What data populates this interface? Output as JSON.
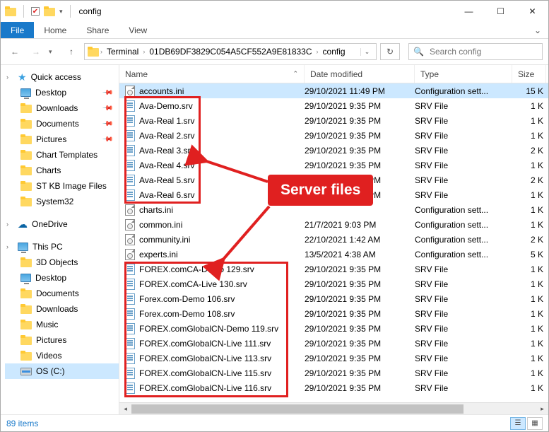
{
  "title": "config",
  "tabs": {
    "file": "File",
    "home": "Home",
    "share": "Share",
    "view": "View"
  },
  "nav": {
    "crumb1": "Terminal",
    "crumb2": "01DB69DF3829C054A5CF552A9E81833C",
    "crumb3": "config"
  },
  "search": {
    "placeholder": "Search config"
  },
  "cols": {
    "name": "Name",
    "date": "Date modified",
    "type": "Type",
    "size": "Size"
  },
  "quick": {
    "label": "Quick access",
    "items": [
      "Desktop",
      "Downloads",
      "Documents",
      "Pictures",
      "Chart Templates",
      "Charts",
      "ST KB Image Files",
      "System32"
    ]
  },
  "onedrive": "OneDrive",
  "thispc": {
    "label": "This PC",
    "items": [
      "3D Objects",
      "Desktop",
      "Documents",
      "Downloads",
      "Music",
      "Pictures",
      "Videos",
      "OS (C:)"
    ]
  },
  "files": [
    {
      "n": "accounts.ini",
      "d": "29/10/2021 11:49 PM",
      "t": "Configuration sett...",
      "s": "15 K",
      "k": "ini"
    },
    {
      "n": "Ava-Demo.srv",
      "d": "29/10/2021 9:35 PM",
      "t": "SRV File",
      "s": "1 K",
      "k": "srv"
    },
    {
      "n": "Ava-Real 1.srv",
      "d": "29/10/2021 9:35 PM",
      "t": "SRV File",
      "s": "1 K",
      "k": "srv"
    },
    {
      "n": "Ava-Real 2.srv",
      "d": "29/10/2021 9:35 PM",
      "t": "SRV File",
      "s": "1 K",
      "k": "srv"
    },
    {
      "n": "Ava-Real 3.srv",
      "d": "29/10/2021 9:35 PM",
      "t": "SRV File",
      "s": "2 K",
      "k": "srv"
    },
    {
      "n": "Ava-Real 4.srv",
      "d": "29/10/2021 9:35 PM",
      "t": "SRV File",
      "s": "1 K",
      "k": "srv"
    },
    {
      "n": "Ava-Real 5.srv",
      "d": "29/10/2021 9:35 PM",
      "t": "SRV File",
      "s": "2 K",
      "k": "srv"
    },
    {
      "n": "Ava-Real 6.srv",
      "d": "29/10/2021 9:35 PM",
      "t": "SRV File",
      "s": "1 K",
      "k": "srv"
    },
    {
      "n": "charts.ini",
      "d": "",
      "t": "Configuration sett...",
      "s": "1 K",
      "k": "ini"
    },
    {
      "n": "common.ini",
      "d": "21/7/2021 9:03 PM",
      "t": "Configuration sett...",
      "s": "1 K",
      "k": "ini"
    },
    {
      "n": "community.ini",
      "d": "22/10/2021 1:42 AM",
      "t": "Configuration sett...",
      "s": "2 K",
      "k": "ini"
    },
    {
      "n": "experts.ini",
      "d": "13/5/2021 4:38 AM",
      "t": "Configuration sett...",
      "s": "5 K",
      "k": "ini"
    },
    {
      "n": "FOREX.comCA-Demo 129.srv",
      "d": "29/10/2021 9:35 PM",
      "t": "SRV File",
      "s": "1 K",
      "k": "srv"
    },
    {
      "n": "FOREX.comCA-Live 130.srv",
      "d": "29/10/2021 9:35 PM",
      "t": "SRV File",
      "s": "1 K",
      "k": "srv"
    },
    {
      "n": "Forex.com-Demo 106.srv",
      "d": "29/10/2021 9:35 PM",
      "t": "SRV File",
      "s": "1 K",
      "k": "srv"
    },
    {
      "n": "Forex.com-Demo 108.srv",
      "d": "29/10/2021 9:35 PM",
      "t": "SRV File",
      "s": "1 K",
      "k": "srv"
    },
    {
      "n": "FOREX.comGlobalCN-Demo 119.srv",
      "d": "29/10/2021 9:35 PM",
      "t": "SRV File",
      "s": "1 K",
      "k": "srv"
    },
    {
      "n": "FOREX.comGlobalCN-Live 111.srv",
      "d": "29/10/2021 9:35 PM",
      "t": "SRV File",
      "s": "1 K",
      "k": "srv"
    },
    {
      "n": "FOREX.comGlobalCN-Live 113.srv",
      "d": "29/10/2021 9:35 PM",
      "t": "SRV File",
      "s": "1 K",
      "k": "srv"
    },
    {
      "n": "FOREX.comGlobalCN-Live 115.srv",
      "d": "29/10/2021 9:35 PM",
      "t": "SRV File",
      "s": "1 K",
      "k": "srv"
    },
    {
      "n": "FOREX.comGlobalCN-Live 116.srv",
      "d": "29/10/2021 9:35 PM",
      "t": "SRV File",
      "s": "1 K",
      "k": "srv"
    }
  ],
  "status": {
    "count": "89 items"
  },
  "annotation": {
    "label": "Server files"
  }
}
